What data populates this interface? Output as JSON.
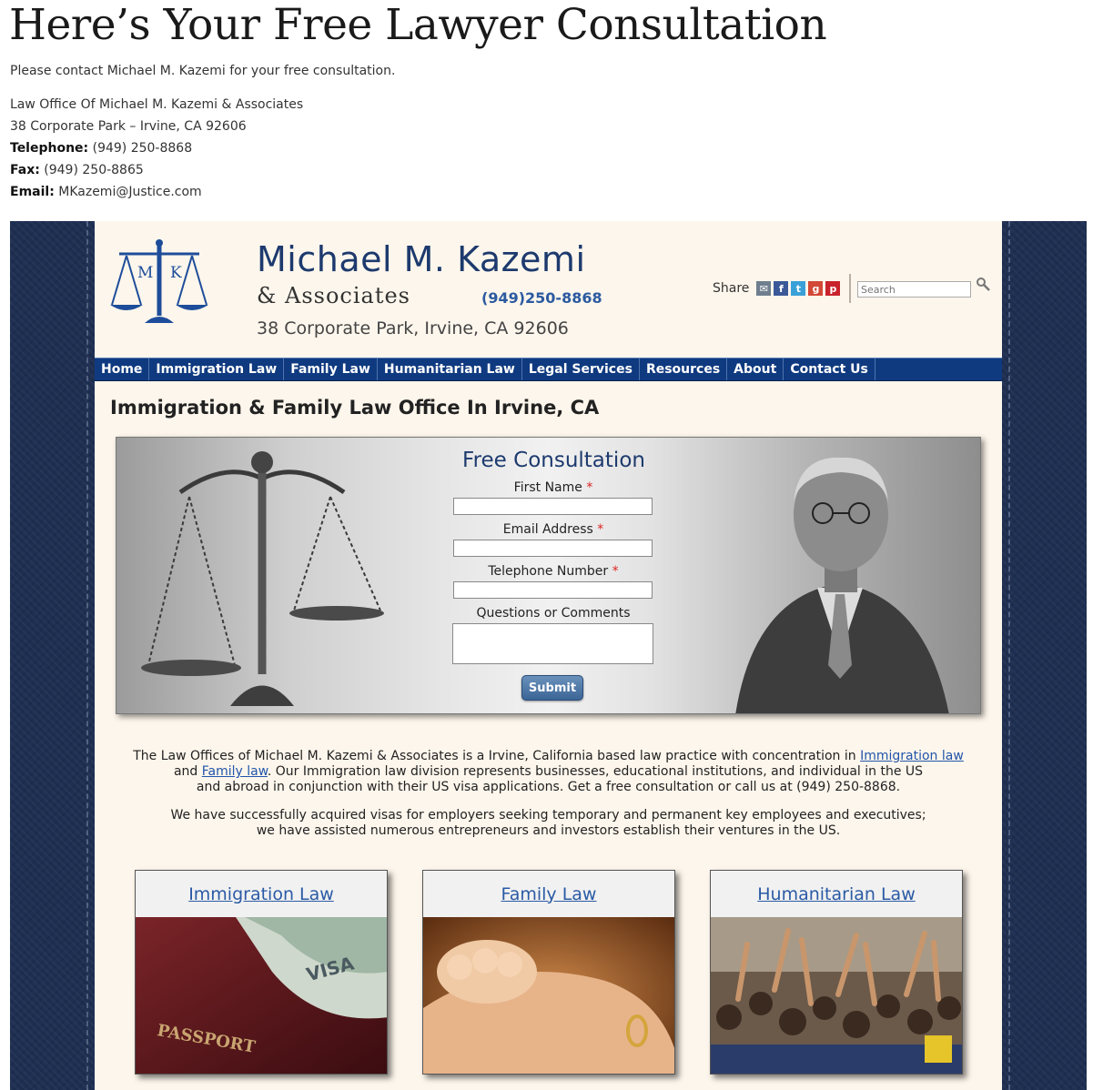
{
  "page": {
    "title": "Here’s Your Free Lawyer Consultation",
    "intro": "Please contact Michael M. Kazemi for your free consultation.",
    "office_name": "Law Office Of Michael M. Kazemi & Associates",
    "office_address": "38 Corporate Park – Irvine, CA 92606",
    "telephone_label": "Telephone:",
    "telephone": "(949) 250-8868",
    "fax_label": "Fax:",
    "fax": "(949) 250-8865",
    "email_label": "Email:",
    "email": "MKazemi@Justice.com"
  },
  "site": {
    "logo_letters": [
      "M",
      "K"
    ],
    "brand_name": "Michael M. Kazemi",
    "brand_assoc": "& Associates",
    "brand_phone": "(949)250-8868",
    "brand_address": "38 Corporate Park, Irvine, CA 92606",
    "share_label": "Share",
    "share_icons": [
      "mail-icon",
      "facebook-icon",
      "twitter-icon",
      "google-plus-icon",
      "pinterest-icon"
    ],
    "search_placeholder": "Search",
    "nav": [
      "Home",
      "Immigration Law",
      "Family Law",
      "Humanitarian Law",
      "Legal Services",
      "Resources",
      "About",
      "Contact Us"
    ],
    "section_title": "Immigration & Family Law Office In Irvine, CA",
    "form": {
      "title": "Free Consultation",
      "first_name": "First Name",
      "email": "Email Address",
      "phone": "Telephone Number",
      "comments": "Questions or Comments",
      "required_mark": "*",
      "submit": "Submit"
    },
    "desc1": {
      "a": "The Law Offices of Michael M. Kazemi & Associates is a Irvine, California based law practice with concentration in ",
      "link1": "Immigration law",
      "b": "and ",
      "link2": "Family law",
      "c": ". Our Immigration law division represents businesses, educational institutions, and individual in the US",
      "d": "and abroad in conjunction with their US visa applications. Get a free consultation or call us at (949) 250-8868."
    },
    "desc2": {
      "line1": "We have successfully acquired visas for employers seeking temporary and permanent key employees and executives;",
      "line2": "we have assisted numerous entrepreneurs and investors establish their ventures in the US."
    },
    "cards": [
      "Immigration Law",
      "Family Law",
      "Humanitarian Law"
    ],
    "card_image_text": {
      "passport": "PASSPORT",
      "visa": "VISA"
    },
    "colors": {
      "nav_bg": "#0f3a80",
      "brand_blue": "#1d3a6e",
      "link_blue": "#2a5aa5",
      "page_bg": "#fdf6ec",
      "leather": "#1e2f52"
    }
  }
}
